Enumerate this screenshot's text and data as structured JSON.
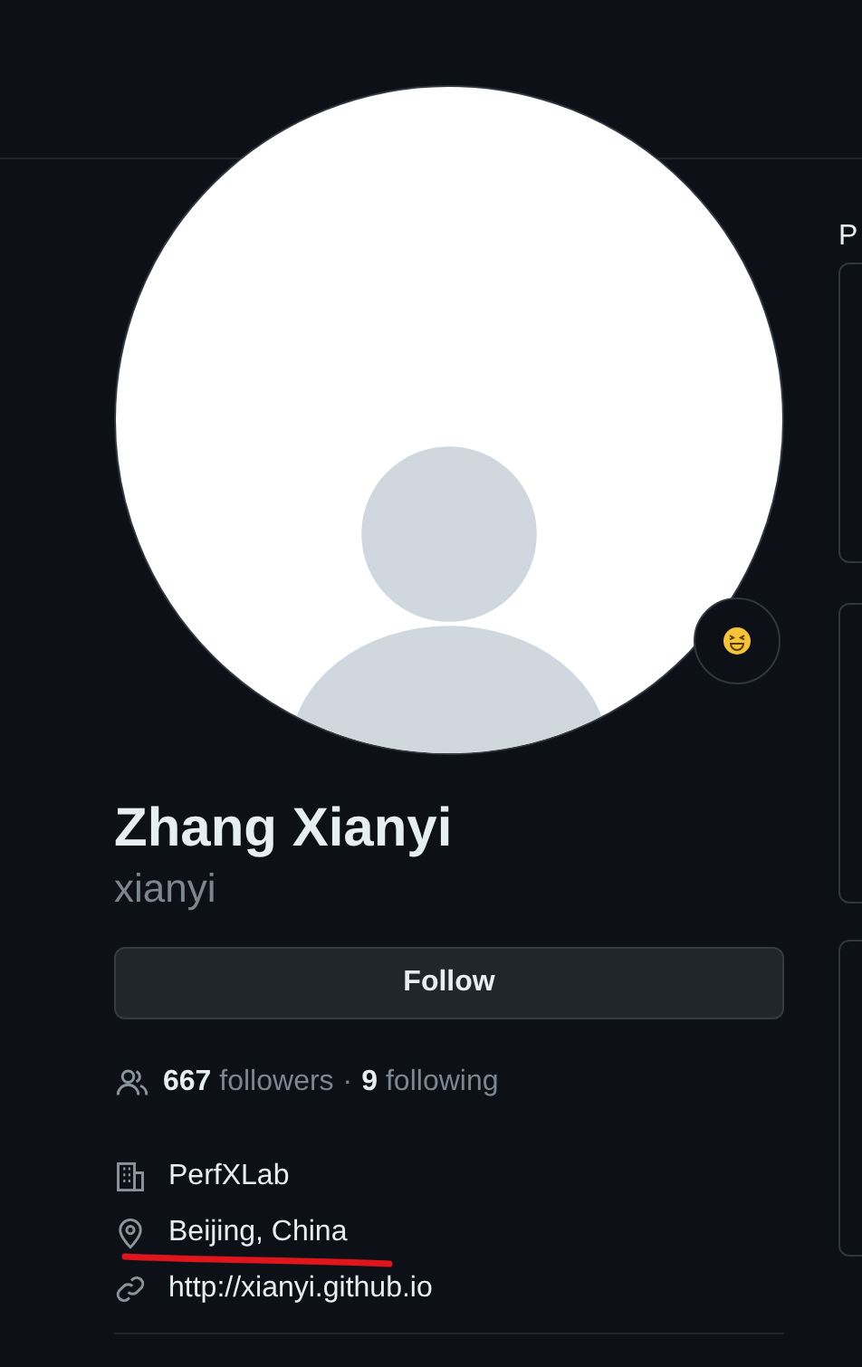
{
  "profile": {
    "name": "Zhang Xianyi",
    "username": "xianyi",
    "follow_button": "Follow",
    "followers": {
      "count": "667",
      "label": "followers",
      "separator": "·"
    },
    "following": {
      "count": "9",
      "label": "following"
    },
    "details": [
      {
        "kind": "organization",
        "text": "PerfXLab"
      },
      {
        "kind": "location",
        "text": "Beijing, China"
      },
      {
        "kind": "link",
        "text": "http://xianyi.github.io"
      }
    ]
  },
  "side_column": {
    "heading": "P"
  }
}
